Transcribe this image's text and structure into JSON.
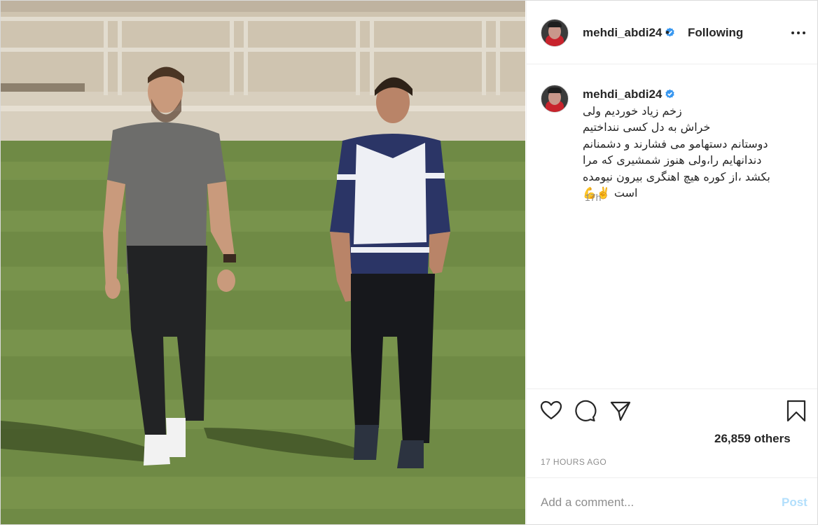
{
  "post": {
    "image_alt": "Two football players walking on a grass pitch in a stadium",
    "image_colors": {
      "grass": "#6f8a45",
      "stands": "#cfc4b0"
    }
  },
  "header": {
    "username": "mehdi_abdi24",
    "separator": "•",
    "follow_status": "Following",
    "verified_icon": "verified-badge-icon",
    "more_icon": "more-options-icon"
  },
  "caption": {
    "username": "mehdi_abdi24",
    "text": "زخم زیاد خوردیم ولی\nخراش به دل کسی ننداختیم\nدوستانم دستهامو می فشارند و دشمنانم\nدندانهایم را،ولی هنوز شمشیری که مرا\nبکشد ،از کوره هیچ اهنگری بیرون نیومده\nاست ✌️💪",
    "time": "17h"
  },
  "actions": {
    "like_icon": "heart-icon",
    "comment_icon": "comment-icon",
    "share_icon": "share-icon",
    "save_icon": "bookmark-icon",
    "likes": "26,859 others",
    "posted": "17 HOURS AGO"
  },
  "comment": {
    "placeholder": "Add a comment...",
    "post_label": "Post"
  },
  "colors": {
    "accent": "#0095f6",
    "verified": "#3897f0",
    "post_disabled": "#b2dffc",
    "muted": "#8e8e8e",
    "border": "#dbdbdb"
  }
}
